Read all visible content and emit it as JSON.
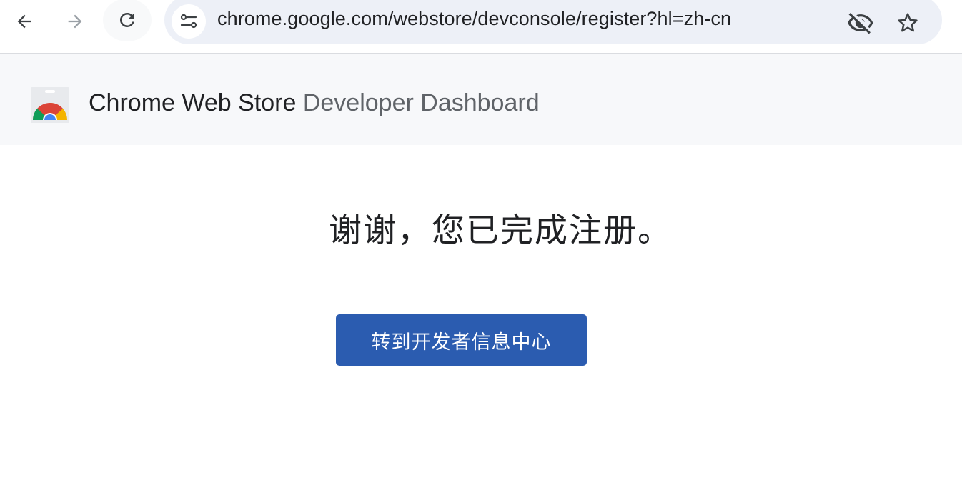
{
  "browser": {
    "url": "chrome.google.com/webstore/devconsole/register?hl=zh-cn",
    "icons": {
      "back": "arrow-back-icon",
      "forward": "arrow-forward-icon",
      "reload": "reload-icon",
      "site_info": "tune-icon",
      "tracking": "eye-off-icon",
      "bookmark": "star-icon"
    }
  },
  "header": {
    "title_primary": "Chrome Web Store",
    "title_secondary": "Developer Dashboard",
    "logo": "chrome-web-store-logo"
  },
  "main": {
    "message": "谢谢，您已完成注册。",
    "button_label": "转到开发者信息中心"
  },
  "colors": {
    "button": "#2b5cb0",
    "header_bg": "#f7f8fa",
    "omnibox_bg": "#edf0f7"
  }
}
